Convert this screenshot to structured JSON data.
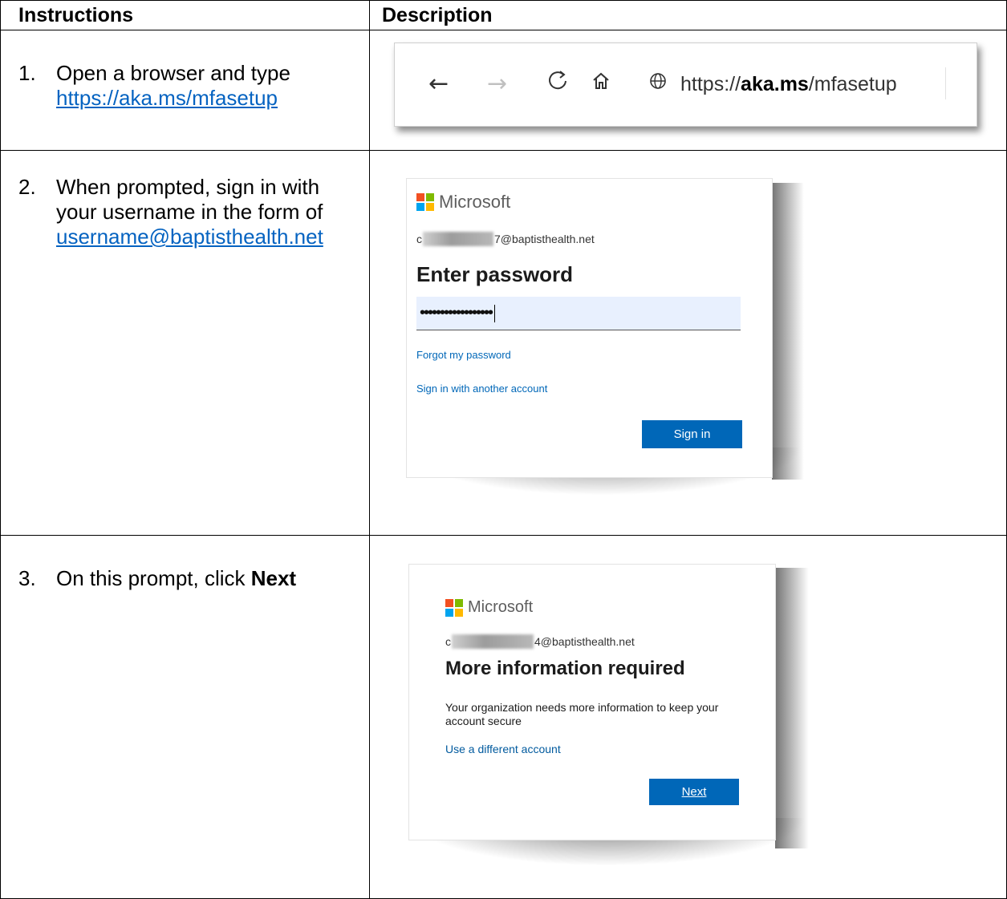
{
  "table": {
    "headers": {
      "instructions": "Instructions",
      "description": "Description"
    },
    "steps": [
      {
        "number": "1.",
        "text": "Open a browser and type ",
        "link": "https://aka.ms/mfasetup",
        "browser": {
          "icons": [
            "back-arrow-icon",
            "forward-arrow-icon",
            "refresh-icon",
            "home-icon",
            "globe-icon"
          ],
          "url_prefix": "https://",
          "url_bold": "aka.ms",
          "url_suffix": "/mfasetup"
        }
      },
      {
        "number": "2.",
        "text": "When prompted, sign in with your username in the form of ",
        "link": "username@baptisthealth.net",
        "dialog": {
          "brand": "Microsoft",
          "account_start": "c",
          "account_end": "7@baptisthealth.net",
          "heading": "Enter password",
          "password_mask": "••••••••••••••••••",
          "forgot_link": "Forgot my password",
          "other_account_link": "Sign in with another account",
          "button": "Sign in"
        }
      },
      {
        "number": "3.",
        "text": "On this prompt, click ",
        "bold": "Next",
        "dialog": {
          "brand": "Microsoft",
          "account_start": "c",
          "account_end": "4@baptisthealth.net",
          "heading": "More information required",
          "body": "Your organization needs more information to keep your account secure",
          "different_account_link": "Use a different account",
          "button": "Next"
        }
      }
    ]
  }
}
